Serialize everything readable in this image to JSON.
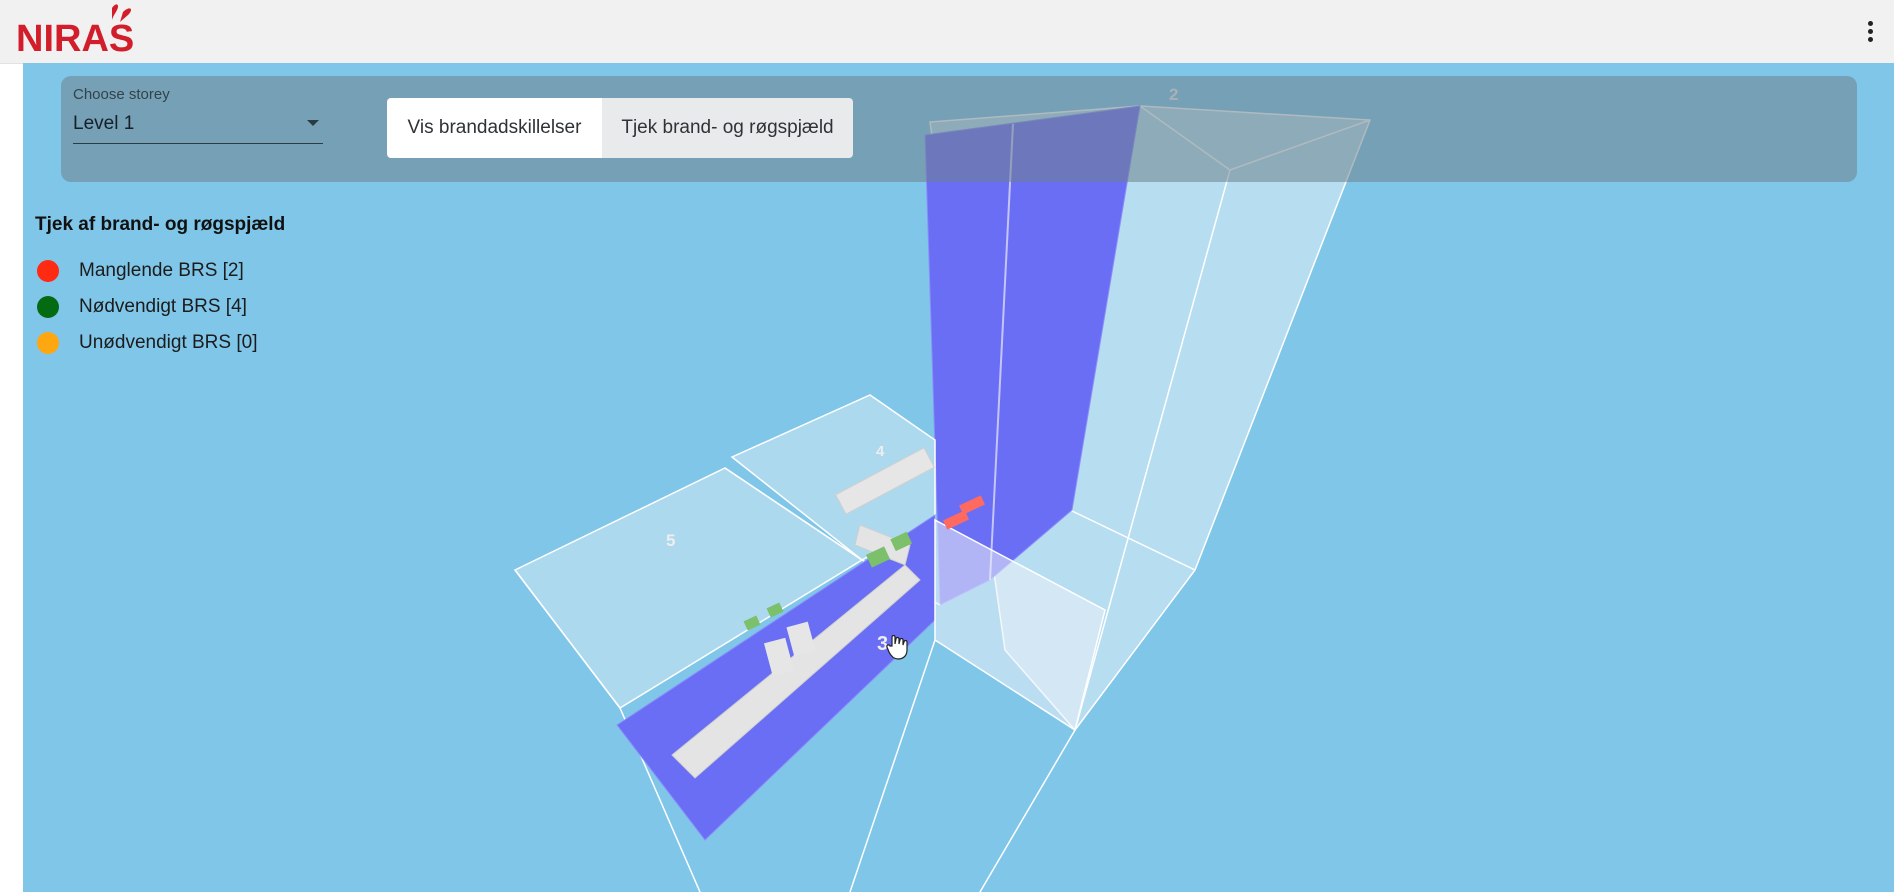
{
  "brand": {
    "logo_text": "NIRAS"
  },
  "toolbar": {
    "storey_label": "Choose storey",
    "storey_value": "Level 1",
    "btn_show": "Vis brandadskillelser",
    "btn_check": "Tjek brand- og røgspjæld"
  },
  "legend": {
    "title": "Tjek af brand- og røgspjæld",
    "items": [
      {
        "label": "Manglende BRS [2]",
        "color": "#ff2a12"
      },
      {
        "label": "Nødvendigt BRS [4]",
        "color": "#046b12"
      },
      {
        "label": "Unødvendigt BRS [0]",
        "color": "#ffa710"
      }
    ]
  },
  "rooms": {
    "r2": "2",
    "r3": "3",
    "r4": "4",
    "r5": "5"
  },
  "colors": {
    "viewport_bg": "#7fc6e9",
    "fire_wall": "#6a6ef4",
    "missing_damper": "#ff6a60",
    "required_damper": "#7cc06c"
  }
}
